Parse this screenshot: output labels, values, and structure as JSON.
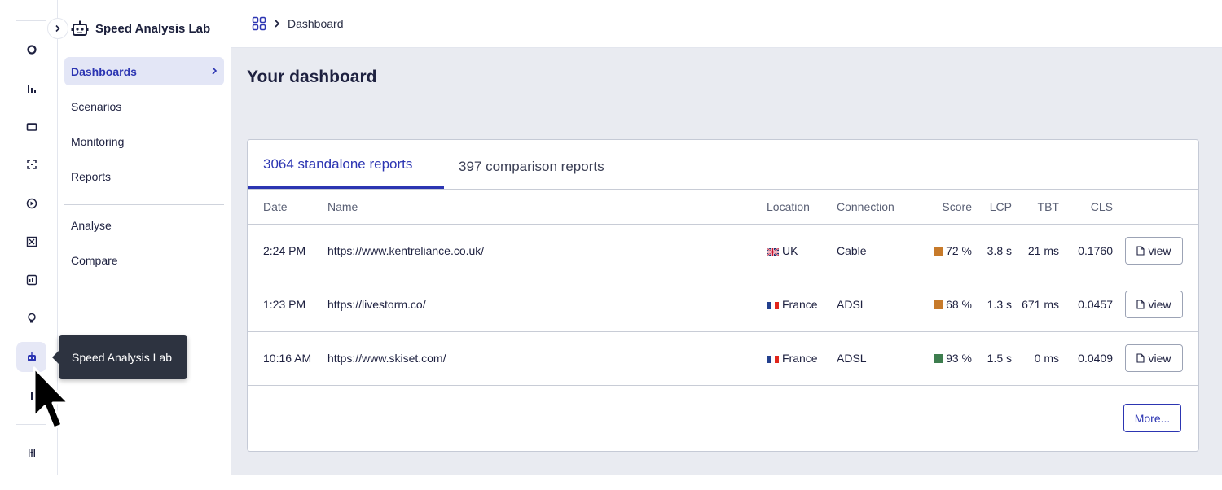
{
  "app": {
    "name": "Speed Analysis Lab"
  },
  "rail": {
    "icons": [
      "circle-icon",
      "bar-chart-icon",
      "window-icon",
      "scan-icon",
      "play-icon",
      "grid-icon",
      "report-icon",
      "bulb-icon",
      "robot-icon",
      "pipe-icon",
      "settings-sliders-icon"
    ],
    "active": "robot-icon"
  },
  "tooltip": {
    "text": "Speed Analysis Lab"
  },
  "sidebar": {
    "brand": "Speed Analysis Lab",
    "items": [
      {
        "label": "Dashboards",
        "active": true
      },
      {
        "label": "Scenarios"
      },
      {
        "label": "Monitoring"
      },
      {
        "label": "Reports"
      }
    ],
    "secondary_items": [
      {
        "label": "Analyse"
      },
      {
        "label": "Compare"
      }
    ]
  },
  "breadcrumb": {
    "current": "Dashboard"
  },
  "main": {
    "title": "Your dashboard",
    "tabs": [
      {
        "label": "3064 standalone reports",
        "active": true
      },
      {
        "label": "397 comparison reports"
      }
    ],
    "table": {
      "headers": [
        "Date",
        "Name",
        "Location",
        "Connection",
        "Score",
        "LCP",
        "TBT",
        "CLS"
      ],
      "rows": [
        {
          "date": "2:24 PM",
          "name": "https://www.kentreliance.co.uk/",
          "location": "UK",
          "flag": "uk-flag-icon",
          "connection": "Cable",
          "score": "72 %",
          "score_color": "#c77a2a",
          "lcp": "3.8 s",
          "tbt": "21 ms",
          "cls": "0.1760",
          "action": "view"
        },
        {
          "date": "1:23 PM",
          "name": "https://livestorm.co/",
          "location": "France",
          "flag": "france-flag-icon",
          "connection": "ADSL",
          "score": "68 %",
          "score_color": "#c77a2a",
          "lcp": "1.3 s",
          "tbt": "671 ms",
          "cls": "0.0457",
          "action": "view"
        },
        {
          "date": "10:16 AM",
          "name": "https://www.skiset.com/",
          "location": "France",
          "flag": "france-flag-icon",
          "connection": "ADSL",
          "score": "93 %",
          "score_color": "#3d7d4e",
          "lcp": "1.5 s",
          "tbt": "0 ms",
          "cls": "0.0409",
          "action": "view"
        }
      ]
    },
    "more_label": "More..."
  },
  "colors": {
    "accent": "#2c35b2",
    "tooltip_bg": "#2d3340",
    "page_bg": "#e9ebf1"
  }
}
